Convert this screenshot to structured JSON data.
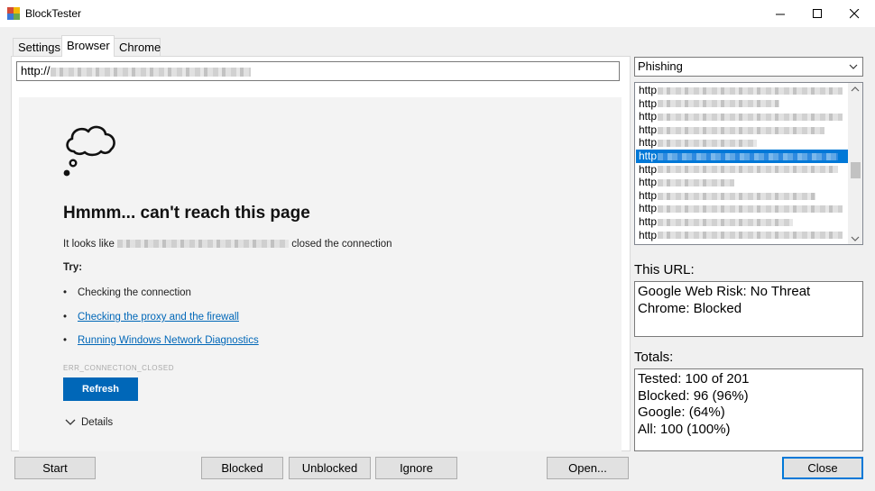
{
  "window": {
    "title": "BlockTester"
  },
  "tabs": [
    {
      "label": "Settings"
    },
    {
      "label": "Browser"
    },
    {
      "label": "Chrome"
    }
  ],
  "browser": {
    "url_prefix": "http://",
    "error_title": "Hmmm... can't reach this page",
    "desc_prefix": "It looks like",
    "desc_suffix": "closed the connection",
    "try_label": "Try:",
    "suggestions": [
      {
        "text": "Checking the connection"
      },
      {
        "text": "Checking the proxy and the firewall"
      },
      {
        "text": "Running Windows Network Diagnostics"
      }
    ],
    "error_code": "ERR_CONNECTION_CLOSED",
    "refresh_label": "Refresh",
    "details_label": "Details"
  },
  "category": {
    "selected": "Phishing"
  },
  "url_list": {
    "item_prefix": "http",
    "selected_index": 5,
    "visible_count": 12
  },
  "this_url": {
    "label": "This URL:",
    "lines": [
      "Google Web Risk: No Threat",
      "Chrome: Blocked"
    ]
  },
  "totals": {
    "label": "Totals:",
    "lines": [
      "Tested: 100 of 201",
      "Blocked: 96 (96%)",
      "Google: (64%)",
      "All: 100 (100%)"
    ]
  },
  "buttons": {
    "start": "Start",
    "blocked": "Blocked",
    "unblocked": "Unblocked",
    "ignore": "Ignore",
    "open": "Open...",
    "close": "Close"
  },
  "colors": {
    "accent": "#0078d7",
    "refresh_button": "#0067b8",
    "link": "#0067b8"
  }
}
